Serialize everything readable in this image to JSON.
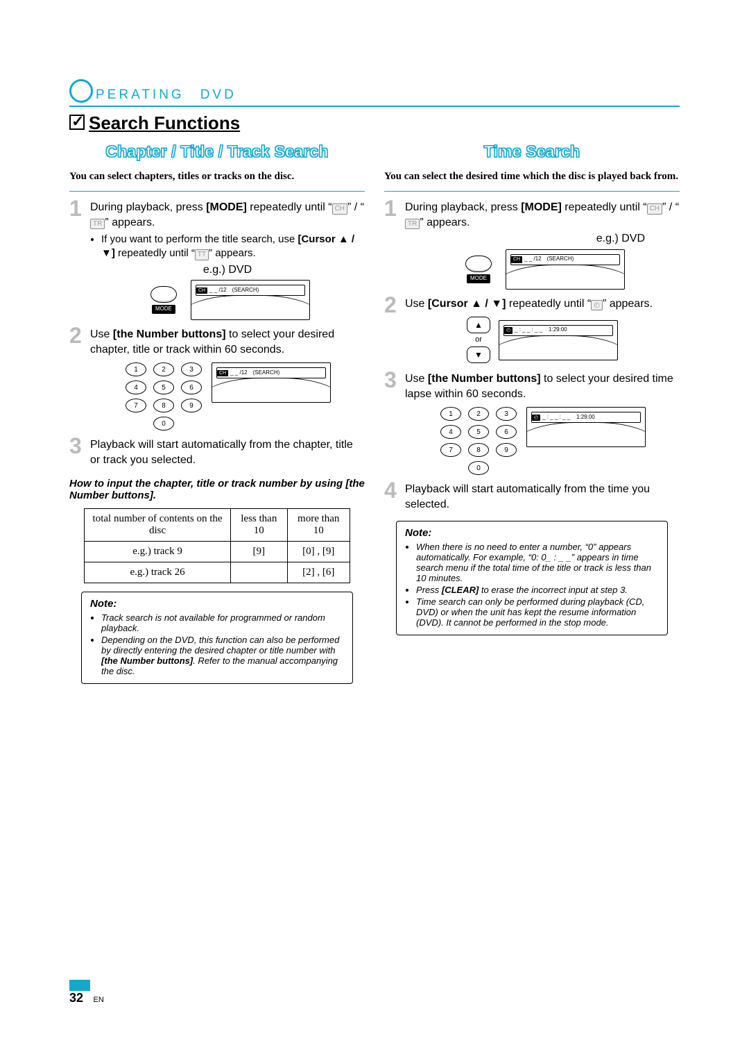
{
  "header": {
    "title": "PERATING DVD"
  },
  "section": {
    "title": "Search Functions"
  },
  "left": {
    "subtitle": "Chapter / Title / Track Search",
    "intro": "You can select chapters, titles or tracks on the disc.",
    "step1": {
      "text_a": "During playback, press ",
      "text_b": " repeatedly until “",
      "text_c": "” / “",
      "text_d": "” appears.",
      "mode": "[MODE]",
      "badge_ch": "CH",
      "badge_tr": "TR",
      "bullet_a": "If you want to perform the title search, use ",
      "bullet_b": " repeatedly until “",
      "bullet_c": "” appears.",
      "cursor": "[Cursor ▲ / ▼]",
      "badge_tt": "TT",
      "eg": "e.g.) DVD",
      "mode_label": "MODE",
      "osd": "_ _ /12 (SEARCH)",
      "osd_chip": "CH"
    },
    "step2": {
      "text_a": "Use ",
      "text_b": " to select your desired chapter, title or track within 60 seconds.",
      "btns": "[the Number buttons]",
      "osd": "_ _ /12 (SEARCH)",
      "osd_chip": "CH"
    },
    "step3": {
      "text": "Playback will start automatically from the chapter, title or track you selected."
    },
    "howto": "How to input the chapter, title or track number by using [the Number buttons].",
    "table": {
      "h1": "total number of contents on the disc",
      "h2": "less than 10",
      "h3": "more than 10",
      "r1c1": "e.g.) track 9",
      "r1c2": "[9]",
      "r1c3": "[0] , [9]",
      "r2c1": "e.g.) track 26",
      "r2c2": "",
      "r2c3": "[2] , [6]"
    },
    "note": {
      "label": "Note:",
      "li1": "Track search is not available for programmed or random playback.",
      "li2_a": "Depending on the DVD, this function can also be performed by directly entering the desired chapter or title number with ",
      "li2_b": ". Refer to the manual accompanying the disc.",
      "li2_btns": "[the Number buttons]"
    }
  },
  "right": {
    "subtitle": "Time Search",
    "intro": "You can select the desired time which the disc is played back from.",
    "step1": {
      "text_a": "During playback, press ",
      "text_b": " repeatedly until “",
      "text_c": "” / “",
      "text_d": "” appears.",
      "mode": "[MODE]",
      "badge_ch": "CH",
      "badge_tr": "TR",
      "eg": "e.g.) DVD",
      "mode_label": "MODE",
      "osd": "_ _ /12 (SEARCH)",
      "osd_chip": "CH"
    },
    "step2": {
      "text_a": "Use ",
      "text_b": " repeatedly until “",
      "text_c": "” appears.",
      "cursor": "[Cursor ▲ / ▼]",
      "badge_clock": "◴",
      "or": "or",
      "osd_chip": "◴",
      "osd": "_ : _ _ : _ _    1:29:00"
    },
    "step3": {
      "text_a": "Use ",
      "text_b": " to select your desired time lapse within 60 seconds.",
      "btns": "[the Number buttons]",
      "osd_chip": "◴",
      "osd": "_ : _ _ : _ _    1:29:00"
    },
    "step4": {
      "text": "Playback will start automatically from the time you selected."
    },
    "note": {
      "label": "Note:",
      "li1": "When there is no need to enter a number, “0” appears automatically. For example, “0: 0_ : _ _” appears in time search menu if the total time of the title or track is less than 10 minutes.",
      "li2_a": "Press ",
      "li2_b": " to erase the incorrect input at step 3.",
      "li2_clear": "[CLEAR]",
      "li3": "Time search can only be performed during playback (CD, DVD) or when the unit has kept the resume information (DVD). It cannot be performed in the stop mode."
    }
  },
  "pagenum": {
    "num": "32",
    "lang": "EN"
  },
  "numpad": [
    "1",
    "2",
    "3",
    "4",
    "5",
    "6",
    "7",
    "8",
    "9",
    "0"
  ]
}
